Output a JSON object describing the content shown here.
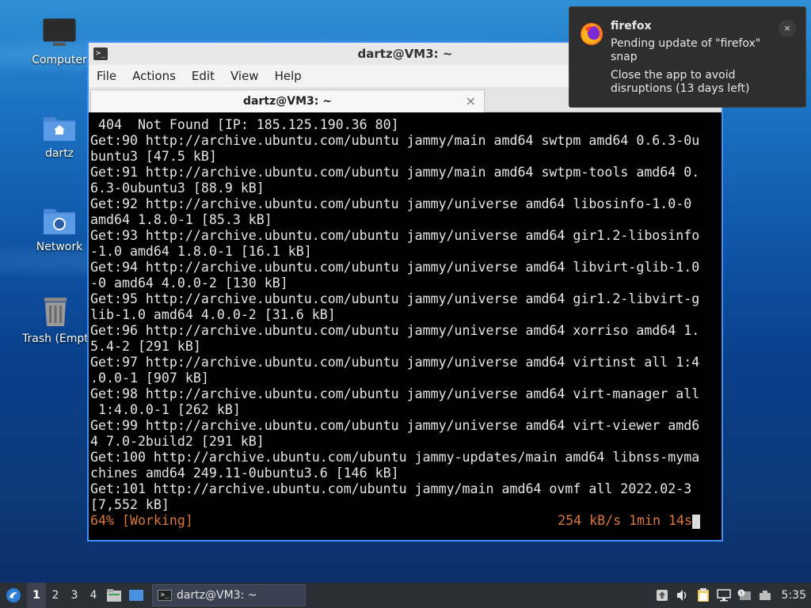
{
  "desktop": {
    "icons": [
      {
        "label": "Computer"
      },
      {
        "label": "dartz"
      },
      {
        "label": "Network"
      },
      {
        "label": "Trash (Empt"
      }
    ]
  },
  "window": {
    "title": "dartz@VM3: ~",
    "menu": [
      "File",
      "Actions",
      "Edit",
      "View",
      "Help"
    ],
    "tab_label": "dartz@VM3: ~",
    "tab_close": "×"
  },
  "terminal": {
    "lines": [
      " 404  Not Found [IP: 185.125.190.36 80]",
      "Get:90 http://archive.ubuntu.com/ubuntu jammy/main amd64 swtpm amd64 0.6.3-0u",
      "buntu3 [47.5 kB]",
      "Get:91 http://archive.ubuntu.com/ubuntu jammy/main amd64 swtpm-tools amd64 0.",
      "6.3-0ubuntu3 [88.9 kB]",
      "Get:92 http://archive.ubuntu.com/ubuntu jammy/universe amd64 libosinfo-1.0-0",
      "amd64 1.8.0-1 [85.3 kB]",
      "Get:93 http://archive.ubuntu.com/ubuntu jammy/universe amd64 gir1.2-libosinfo",
      "-1.0 amd64 1.8.0-1 [16.1 kB]",
      "Get:94 http://archive.ubuntu.com/ubuntu jammy/universe amd64 libvirt-glib-1.0",
      "-0 amd64 4.0.0-2 [130 kB]",
      "Get:95 http://archive.ubuntu.com/ubuntu jammy/universe amd64 gir1.2-libvirt-g",
      "lib-1.0 amd64 4.0.0-2 [31.6 kB]",
      "Get:96 http://archive.ubuntu.com/ubuntu jammy/universe amd64 xorriso amd64 1.",
      "5.4-2 [291 kB]",
      "Get:97 http://archive.ubuntu.com/ubuntu jammy/universe amd64 virtinst all 1:4",
      ".0.0-1 [907 kB]",
      "Get:98 http://archive.ubuntu.com/ubuntu jammy/universe amd64 virt-manager all",
      " 1:4.0.0-1 [262 kB]",
      "Get:99 http://archive.ubuntu.com/ubuntu jammy/universe amd64 virt-viewer amd6",
      "4 7.0-2build2 [291 kB]",
      "Get:100 http://archive.ubuntu.com/ubuntu jammy-updates/main amd64 libnss-myma",
      "chines amd64 249.11-0ubuntu3.6 [146 kB]",
      "Get:101 http://archive.ubuntu.com/ubuntu jammy/main amd64 ovmf all 2022.02-3",
      "[7,552 kB]"
    ],
    "status_left": "64% [Working]",
    "status_right": "254 kB/s 1min 14s"
  },
  "notification": {
    "title": "firefox",
    "line1": "Pending update of \"firefox\" snap",
    "line2": "Close the app to avoid disruptions (13 days left)",
    "close": "×"
  },
  "taskbar": {
    "workspaces": [
      "1",
      "2",
      "3",
      "4"
    ],
    "task_label": "dartz@VM3: ~",
    "clock": "5:35"
  }
}
